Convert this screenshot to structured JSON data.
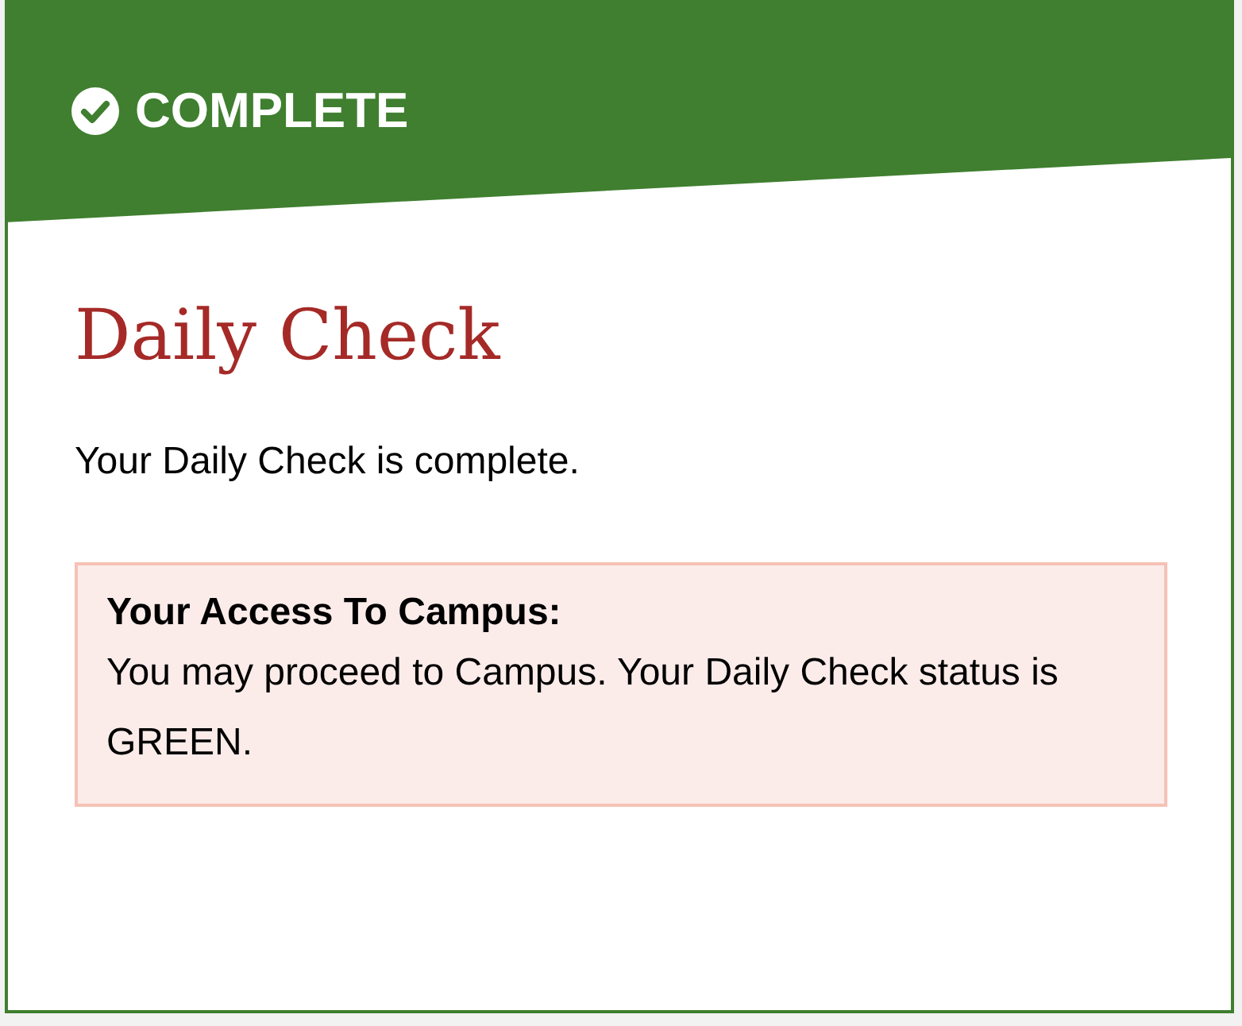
{
  "banner": {
    "kind": "complete",
    "label": "COMPLETE"
  },
  "title": "Daily Check",
  "message": "Your Daily Check is complete.",
  "alert": {
    "heading": "Your Access To Campus:",
    "text": "You may proceed to Campus. Your Daily Check status is GREEN."
  }
}
